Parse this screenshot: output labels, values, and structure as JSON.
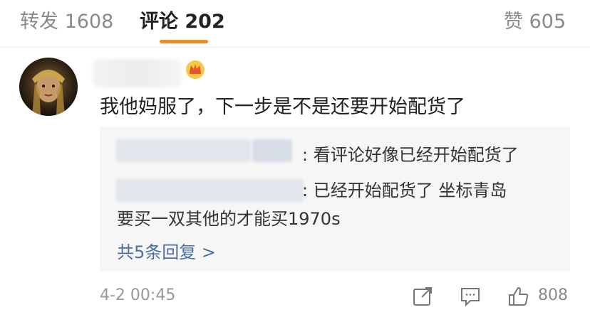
{
  "tabs": [
    {
      "label": "转发 1608",
      "active": false
    },
    {
      "label": "评论 202",
      "active": true
    },
    {
      "label": "赞 605",
      "active": false
    }
  ],
  "comment": {
    "text": "我他妈服了，下一步是不是还要开始配货了",
    "badge_icon": "crown-icon",
    "time": "4-2 00:45",
    "like_count": "808"
  },
  "replies": {
    "lines": [
      ": 看评论好像已经开始配货了",
      ": 已经开始配货了 坐标青岛",
      "要买一双其他的才能买1970s"
    ],
    "more_label": "共5条回复 >"
  },
  "colors": {
    "accent": "#f08a24",
    "link": "#4a6fa5",
    "reply_bg": "#f6f6f6"
  }
}
